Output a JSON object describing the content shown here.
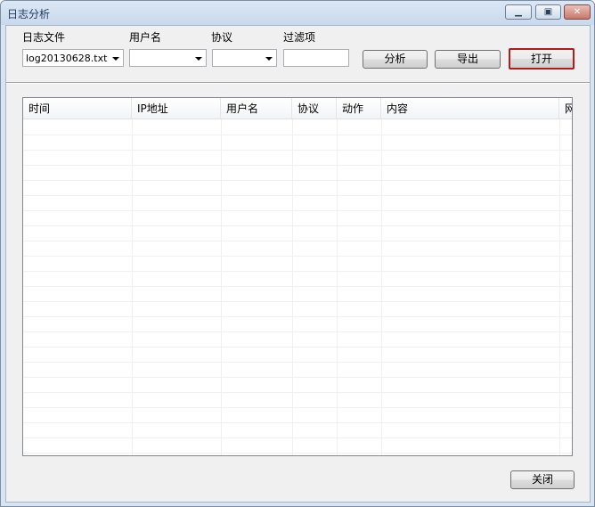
{
  "window": {
    "title": "日志分析"
  },
  "toolbar": {
    "log_file_label": "日志文件",
    "log_file_value": "log20130628.txt",
    "username_label": "用户名",
    "username_value": "",
    "protocol_label": "协议",
    "protocol_value": "",
    "filter_label": "过滤项",
    "filter_value": "",
    "analyze_label": "分析",
    "export_label": "导出",
    "open_label": "打开"
  },
  "table": {
    "columns": [
      "时间",
      "IP地址",
      "用户名",
      "协议",
      "动作",
      "内容",
      "网"
    ],
    "rows": []
  },
  "footer": {
    "close_label": "关闭"
  }
}
